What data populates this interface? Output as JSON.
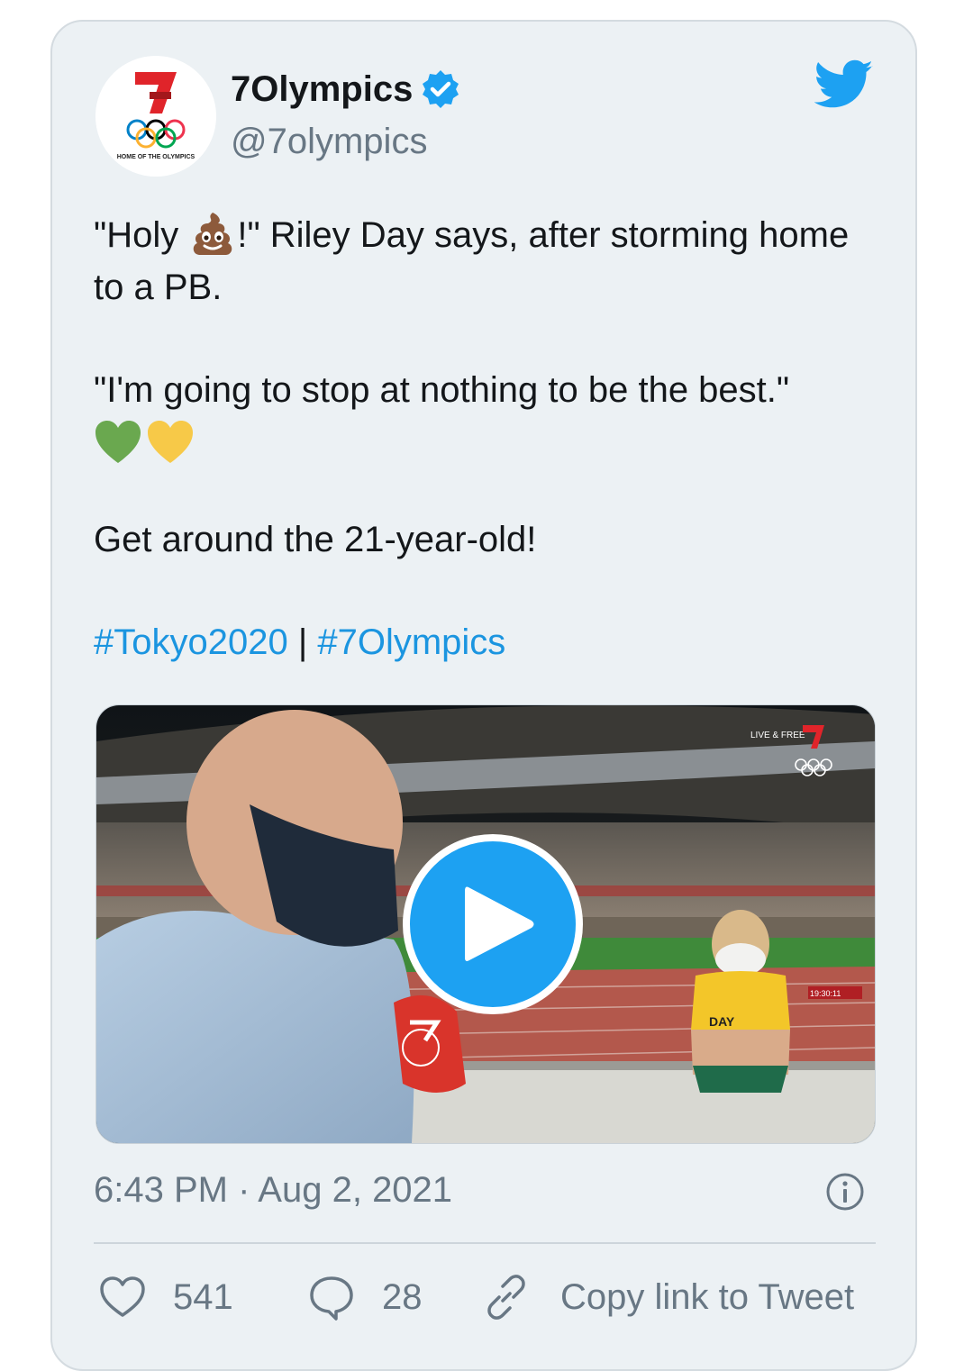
{
  "tweet": {
    "display_name": "7Olympics",
    "handle": "@7olympics",
    "avatar_caption": "HOME OF THE OLYMPICS",
    "text_line1_pre": "\"Holy ",
    "text_line1_post": "!\" Riley Day says, after storming home to a PB.",
    "text_quote": "\"I'm going to stop at nothing to be the best.\"",
    "text_line3": "Get around the 21-year-old!",
    "hashtag1": "#Tokyo2020",
    "hashtag_sep": " | ",
    "hashtag2": "#7Olympics",
    "timestamp": "6:43 PM · Aug 2, 2021"
  },
  "media": {
    "overlay_live": "LIVE & FREE",
    "bib_text": "DAY",
    "board_time": "19:30:11"
  },
  "actions": {
    "likes": "541",
    "replies": "28",
    "copy_label": "Copy link to Tweet"
  },
  "colors": {
    "link": "#1b95e0",
    "twitter_blue": "#1da1f2",
    "brand_red": "#e0242a",
    "card_bg": "#ecf1f4"
  },
  "icons": [
    "verified-badge-icon",
    "twitter-bird-icon",
    "poop-emoji-icon",
    "green-heart-icon",
    "yellow-heart-icon",
    "play-icon",
    "info-icon",
    "heart-icon",
    "reply-bubble-icon",
    "link-icon"
  ]
}
